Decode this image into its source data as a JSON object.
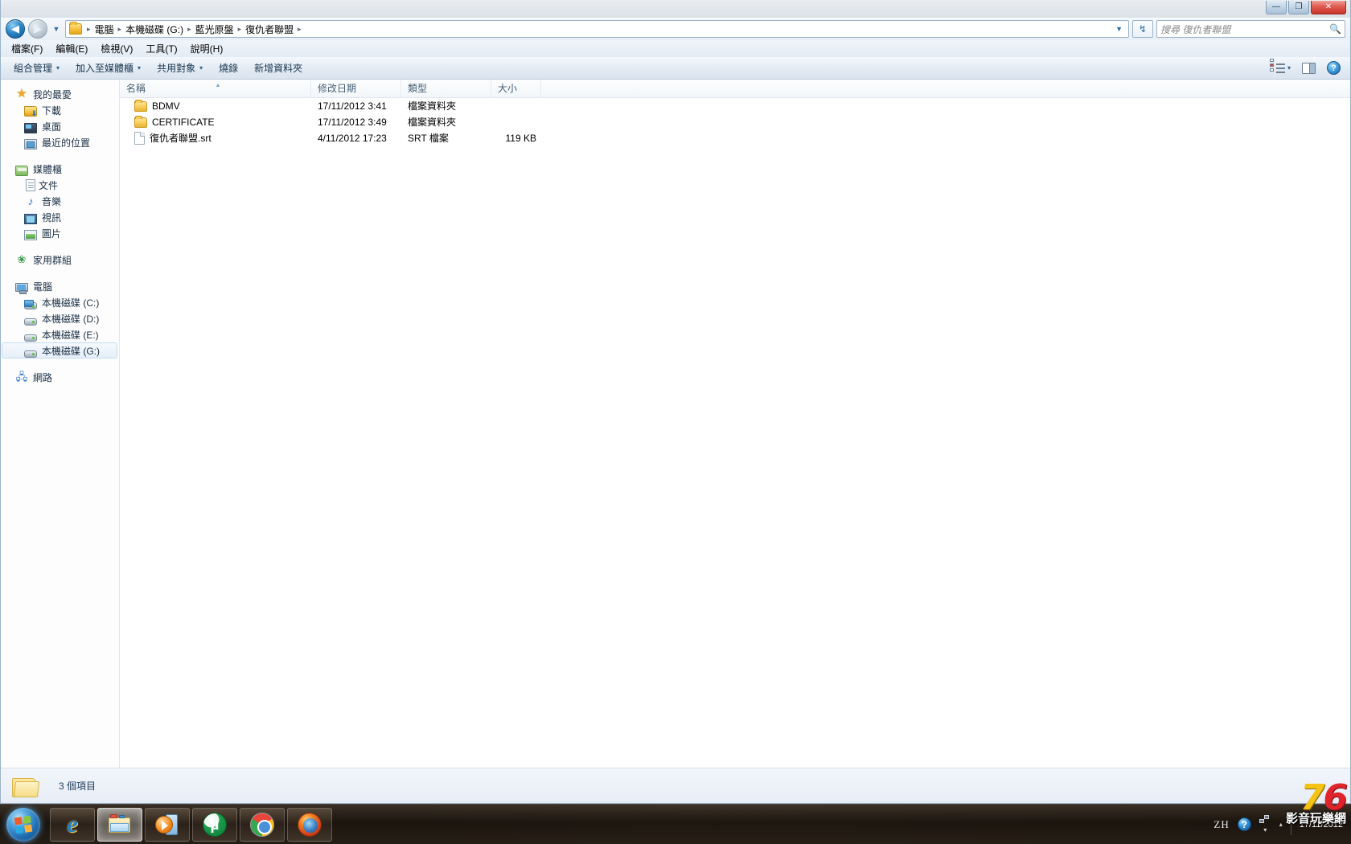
{
  "window": {
    "controls": {
      "minimize": "—",
      "maximize": "❐",
      "close": "✕"
    }
  },
  "address": {
    "back_icon": "◀",
    "forward_icon": "▶",
    "history_caret": "▼",
    "folder_icon": "folder-icon",
    "breadcrumbs": [
      "電腦",
      "本機磁碟 (G:)",
      "藍光原盤",
      "復仇者聯盟"
    ],
    "separator": "▸",
    "refresh_icon": "↯",
    "search_placeholder": "搜尋 復仇者聯盟",
    "search_icon": "🔍"
  },
  "menubar": {
    "items": [
      "檔案(F)",
      "編輯(E)",
      "檢視(V)",
      "工具(T)",
      "說明(H)"
    ]
  },
  "toolbar": {
    "organize": "組合管理",
    "include_in_library": "加入至媒體櫃",
    "share_with": "共用對象",
    "burn": "燒錄",
    "new_folder": "新增資料夾",
    "caret": "▾",
    "views_caret": "▾"
  },
  "navpane": {
    "groups": [
      {
        "header": {
          "label": "我的最愛",
          "icon": "star-icon"
        },
        "items": [
          {
            "label": "下載",
            "icon": "downloads-icon"
          },
          {
            "label": "桌面",
            "icon": "desktop-icon"
          },
          {
            "label": "最近的位置",
            "icon": "recent-places-icon"
          }
        ]
      },
      {
        "header": {
          "label": "媒體櫃",
          "icon": "library-icon"
        },
        "items": [
          {
            "label": "文件",
            "icon": "documents-icon"
          },
          {
            "label": "音樂",
            "icon": "music-icon"
          },
          {
            "label": "視訊",
            "icon": "videos-icon"
          },
          {
            "label": "圖片",
            "icon": "pictures-icon"
          }
        ]
      },
      {
        "header": {
          "label": "家用群組",
          "icon": "homegroup-icon"
        },
        "items": []
      },
      {
        "header": {
          "label": "電腦",
          "icon": "computer-icon"
        },
        "items": [
          {
            "label": "本機磁碟 (C:)",
            "icon": "system-drive-icon",
            "selected": false
          },
          {
            "label": "本機磁碟 (D:)",
            "icon": "drive-icon",
            "selected": false
          },
          {
            "label": "本機磁碟 (E:)",
            "icon": "drive-icon",
            "selected": false
          },
          {
            "label": "本機磁碟 (G:)",
            "icon": "drive-icon",
            "selected": true
          }
        ]
      },
      {
        "header": {
          "label": "網路",
          "icon": "network-icon"
        },
        "items": []
      }
    ]
  },
  "filelist": {
    "columns": [
      "名稱",
      "修改日期",
      "類型",
      "大小"
    ],
    "sort_indicator": "▲",
    "rows": [
      {
        "icon": "folder-icon",
        "name": "BDMV",
        "date": "17/11/2012 3:41",
        "type": "檔案資料夾",
        "size": ""
      },
      {
        "icon": "folder-icon",
        "name": "CERTIFICATE",
        "date": "17/11/2012 3:49",
        "type": "檔案資料夾",
        "size": ""
      },
      {
        "icon": "file-icon",
        "name": "復仇者聯盟.srt",
        "date": "4/11/2012 17:23",
        "type": "SRT 檔案",
        "size": "119 KB"
      }
    ]
  },
  "statusbar": {
    "icon": "folder-icon",
    "item_count": "3 個項目"
  },
  "taskbar": {
    "start_label": "start-orb",
    "buttons": [
      {
        "name": "internet-explorer",
        "active": false
      },
      {
        "name": "windows-explorer",
        "active": true
      },
      {
        "name": "windows-media-player",
        "active": false
      },
      {
        "name": "utorrent",
        "active": false
      },
      {
        "name": "google-chrome",
        "active": false
      },
      {
        "name": "mozilla-firefox",
        "active": false
      }
    ],
    "tray": {
      "ime": "ZH",
      "help": "?",
      "network_icon": "network-tray-icon",
      "show_hidden_caret": "▴",
      "expand_caret": "▾",
      "date": "17/11/2012"
    }
  },
  "watermark": {
    "digit_7": "7",
    "digit_6": "6",
    "text": "影音玩樂網"
  }
}
